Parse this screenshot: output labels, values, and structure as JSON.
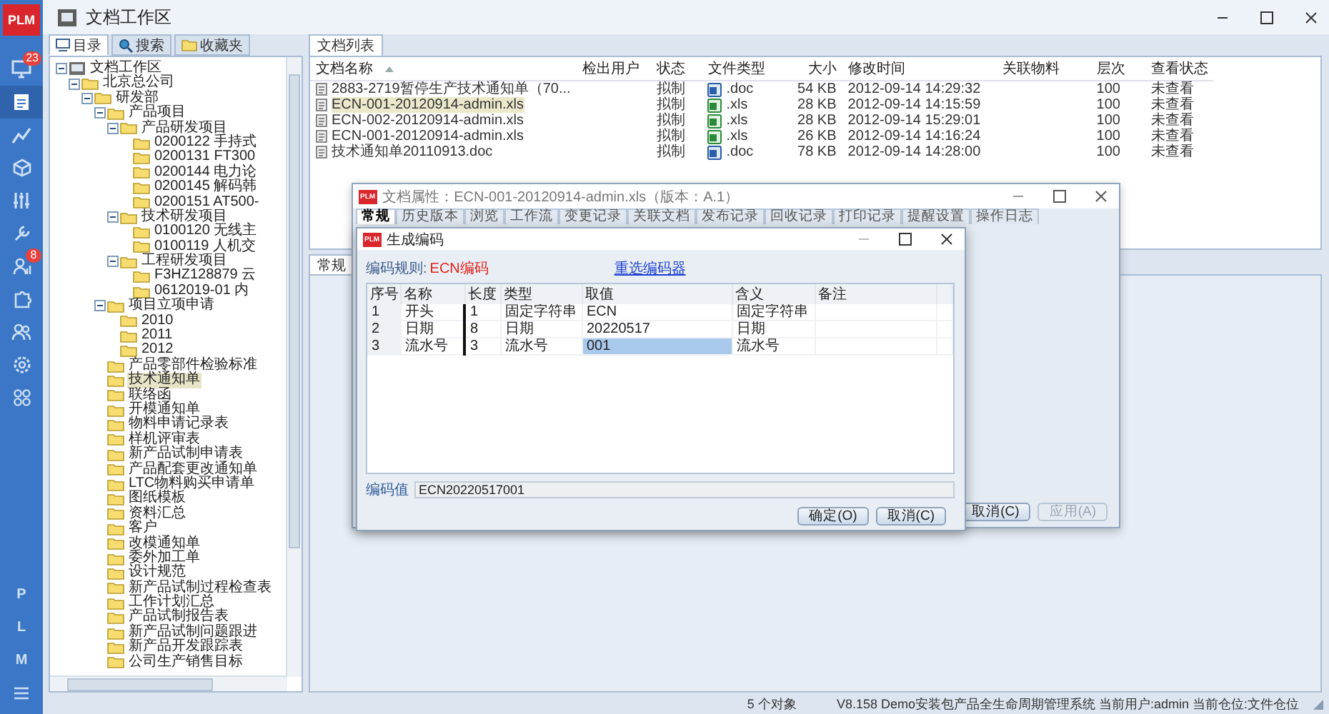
{
  "app_logo": "PLM",
  "nav": [
    {
      "selected": false,
      "badge": "23"
    },
    {
      "selected": true
    },
    {
      "selected": false
    },
    {
      "selected": false
    },
    {
      "selected": false
    },
    {
      "selected": false
    },
    {
      "selected": false,
      "badge": "8"
    },
    {
      "selected": false
    },
    {
      "selected": false
    },
    {
      "selected": false
    },
    {
      "selected": false
    }
  ],
  "nav_letters": [
    "P",
    "L",
    "M"
  ],
  "window": {
    "title": "文档工作区"
  },
  "side_tabs": [
    {
      "label": "目录",
      "selected": true
    },
    {
      "label": "搜索",
      "selected": false
    },
    {
      "label": "收藏夹",
      "selected": false
    }
  ],
  "tree": [
    {
      "label": "文档工作区",
      "expanded": true,
      "selected": false,
      "children": [
        {
          "label": "北京总公司",
          "expanded": true,
          "selected": false,
          "children": [
            {
              "label": "研发部",
              "expanded": true,
              "selected": false,
              "children": [
                {
                  "label": "产品项目",
                  "expanded": true,
                  "selected": false,
                  "children": [
                    {
                      "label": "产品研发项目",
                      "expanded": true,
                      "selected": false,
                      "children": [
                        {
                          "label": "0200122 手持式",
                          "selected": false
                        },
                        {
                          "label": "0200131 FT300",
                          "selected": false
                        },
                        {
                          "label": "0200144 电力论",
                          "selected": false
                        },
                        {
                          "label": "0200145 解码韩",
                          "selected": false
                        },
                        {
                          "label": "0200151 AT500-",
                          "selected": false
                        }
                      ]
                    },
                    {
                      "label": "技术研发项目",
                      "expanded": true,
                      "selected": false,
                      "children": [
                        {
                          "label": "0100120 无线主",
                          "selected": false
                        },
                        {
                          "label": "0100119 人机交",
                          "selected": false
                        }
                      ]
                    },
                    {
                      "label": "工程研发项目",
                      "expanded": true,
                      "selected": false,
                      "children": [
                        {
                          "label": "F3HZ128879 云",
                          "selected": false
                        },
                        {
                          "label": "0612019-01 内",
                          "selected": false
                        }
                      ]
                    }
                  ]
                },
                {
                  "label": "项目立项申请",
                  "expanded": true,
                  "selected": false,
                  "children": [
                    {
                      "label": "2010",
                      "selected": false
                    },
                    {
                      "label": "2011",
                      "selected": false
                    },
                    {
                      "label": "2012",
                      "selected": false
                    }
                  ]
                },
                {
                  "label": "产品零部件检验标准",
                  "selected": false
                },
                {
                  "label": "技术通知单",
                  "selected": true
                },
                {
                  "label": "联络函",
                  "selected": false
                },
                {
                  "label": "开模通知单",
                  "selected": false
                },
                {
                  "label": "物料申请记录表",
                  "selected": false
                },
                {
                  "label": "样机评审表",
                  "selected": false
                },
                {
                  "label": "新产品试制申请表",
                  "selected": false
                },
                {
                  "label": "产品配套更改通知单",
                  "selected": false
                },
                {
                  "label": "LTC物料购买申请单",
                  "selected": false
                },
                {
                  "label": "图纸模板",
                  "selected": false
                },
                {
                  "label": "资料汇总",
                  "selected": false
                },
                {
                  "label": "客户",
                  "selected": false
                },
                {
                  "label": "改模通知单",
                  "selected": false
                },
                {
                  "label": "委外加工单",
                  "selected": false
                },
                {
                  "label": "设计规范",
                  "selected": false
                },
                {
                  "label": "新产品试制过程检查表",
                  "selected": false
                },
                {
                  "label": "工作计划汇总",
                  "selected": false
                },
                {
                  "label": "产品试制报告表",
                  "selected": false
                },
                {
                  "label": "新产品试制问题跟进",
                  "selected": false
                },
                {
                  "label": "新产品开发跟踪表",
                  "selected": false
                },
                {
                  "label": "公司生产销售目标",
                  "selected": false
                }
              ]
            }
          ]
        }
      ]
    }
  ],
  "doc_list": {
    "tab": "文档列表",
    "columns": [
      "文档名称",
      "检出用户",
      "状态",
      "文件类型",
      "大小",
      "修改时间",
      "关联物料",
      "层次",
      "查看状态"
    ],
    "rows": [
      {
        "name": "2883-2719暂停生产技术通知单（70...",
        "status": "拟制",
        "file_type": ".doc",
        "kind": "doc",
        "size": "54 KB",
        "modified": "2012-09-14 14:29:32",
        "layer": "100",
        "view_status": "未查看",
        "selected": false
      },
      {
        "name": "ECN-001-20120914-admin.xls",
        "status": "拟制",
        "file_type": ".xls",
        "kind": "xls",
        "size": "28 KB",
        "modified": "2012-09-14 14:15:59",
        "layer": "100",
        "view_status": "未查看",
        "selected": true
      },
      {
        "name": "ECN-002-20120914-admin.xls",
        "status": "拟制",
        "file_type": ".xls",
        "kind": "xls",
        "size": "28 KB",
        "modified": "2012-09-14 15:29:01",
        "layer": "100",
        "view_status": "未查看",
        "selected": false
      },
      {
        "name": "ECN-001-20120914-admin.xls",
        "status": "拟制",
        "file_type": ".xls",
        "kind": "xls",
        "size": "26 KB",
        "modified": "2012-09-14 14:16:24",
        "layer": "100",
        "view_status": "未查看",
        "selected": false
      },
      {
        "name": "技术通知单20110913.doc",
        "status": "拟制",
        "file_type": ".doc",
        "kind": "doc",
        "size": "78 KB",
        "modified": "2012-09-14 14:28:00",
        "layer": "100",
        "view_status": "未查看",
        "selected": false
      }
    ]
  },
  "lower_tab": "常规",
  "properties_dialog": {
    "logo": "PLM",
    "title": "文档属性：ECN-001-20120914-admin.xls（版本：A.1）",
    "tabs": [
      {
        "label": "常规",
        "selected": true
      },
      {
        "label": "历史版本",
        "selected": false
      },
      {
        "label": "浏览",
        "selected": false
      },
      {
        "label": "工作流",
        "selected": false
      },
      {
        "label": "变更记录",
        "selected": false
      },
      {
        "label": "关联文档",
        "selected": false
      },
      {
        "label": "发布记录",
        "selected": false
      },
      {
        "label": "回收记录",
        "selected": false
      },
      {
        "label": "打印记录",
        "selected": false
      },
      {
        "label": "提醒设置",
        "selected": false
      },
      {
        "label": "操作日志",
        "selected": false
      }
    ],
    "buttons": [
      {
        "label": "取消(C)",
        "disabled": false
      },
      {
        "label": "应用(A)",
        "disabled": true
      }
    ]
  },
  "code_dialog": {
    "logo": "PLM",
    "title": "生成编码",
    "rule_label": "编码规则:",
    "rule_value": "ECN编码",
    "reselect_link": "重选编码器",
    "columns": [
      "序号",
      "名称",
      "长度",
      "类型",
      "取值",
      "含义",
      "备注"
    ],
    "rows": [
      {
        "index": "1",
        "name": "开头",
        "length": "1",
        "type": "固定字符串",
        "value": "ECN",
        "meaning": "固定字符串",
        "value_selected": false
      },
      {
        "index": "2",
        "name": "日期",
        "length": "8",
        "type": "日期",
        "value": "20220517",
        "meaning": "日期",
        "value_selected": false
      },
      {
        "index": "3",
        "name": "流水号",
        "length": "3",
        "type": "流水号",
        "value": "001",
        "meaning": "流水号",
        "value_selected": true
      }
    ],
    "code_value_label": "编码值",
    "code_value": "ECN20220517001",
    "buttons": [
      "确定(O)",
      "取消(C)"
    ]
  },
  "status_bar": {
    "count": "5 个对象",
    "info": "V8.158 Demo安装包产品全生命周期管理系统  当前用户:admin  当前仓位:文件仓位"
  }
}
